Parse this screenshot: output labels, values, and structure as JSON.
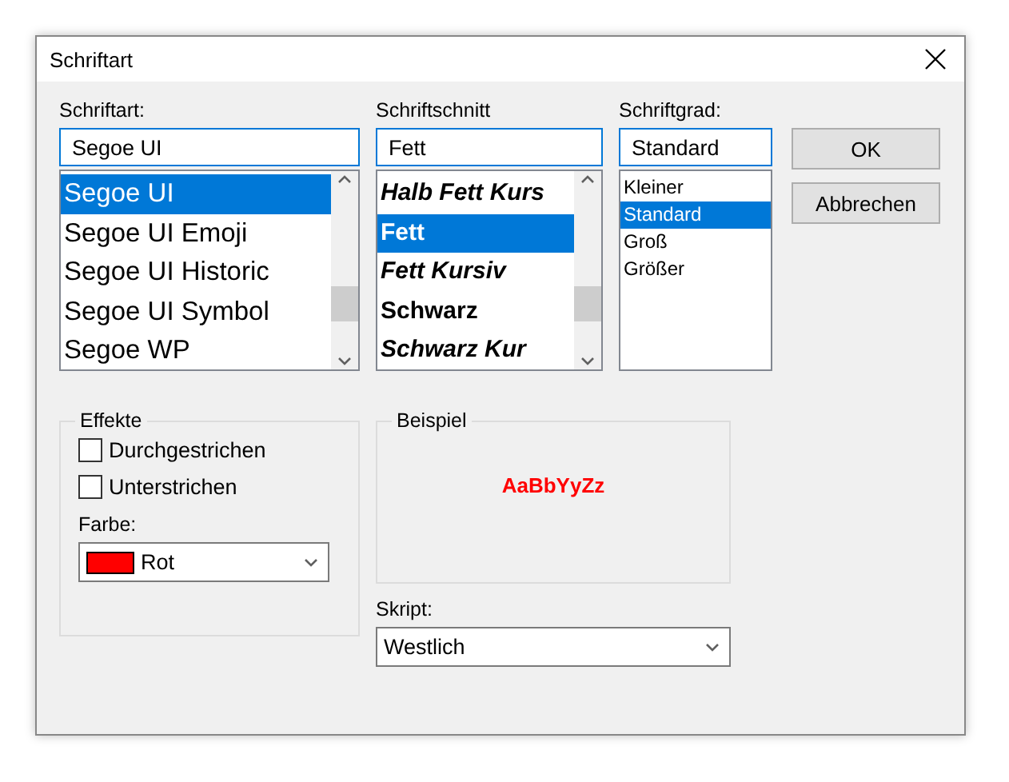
{
  "window": {
    "title": "Schriftart"
  },
  "font": {
    "label": "Schriftart:",
    "value": "Segoe UI",
    "items": [
      {
        "label": "Segoe UI",
        "selected": true
      },
      {
        "label": "Segoe UI Emoji",
        "selected": false
      },
      {
        "label": "Segoe UI Historic",
        "selected": false
      },
      {
        "label": "Segoe UI Symbol",
        "selected": false
      },
      {
        "label": "Segoe WP",
        "selected": false
      }
    ]
  },
  "style": {
    "label": "Schriftschnitt",
    "value": "Fett",
    "items": [
      {
        "label": "Halb Fett Kurs",
        "kind": "bolditalic",
        "selected": false
      },
      {
        "label": "Fett",
        "kind": "bold",
        "selected": true
      },
      {
        "label": "Fett Kursiv",
        "kind": "bolditalic",
        "selected": false
      },
      {
        "label": "Schwarz",
        "kind": "bold",
        "selected": false
      },
      {
        "label": "Schwarz Kur",
        "kind": "bolditalic",
        "selected": false
      }
    ]
  },
  "size": {
    "label": "Schriftgrad:",
    "value": "Standard",
    "items": [
      {
        "label": "Kleiner",
        "selected": false
      },
      {
        "label": "Standard",
        "selected": true
      },
      {
        "label": "Groß",
        "selected": false
      },
      {
        "label": "Größer",
        "selected": false
      }
    ]
  },
  "buttons": [
    "OK",
    "Abbrechen"
  ],
  "effects": {
    "title": "Effekte",
    "options": [
      {
        "label": "Durchgestrichen",
        "checked": false
      },
      {
        "label": "Unterstrichen",
        "checked": false
      }
    ],
    "color_label": "Farbe:",
    "color": {
      "label": "Rot",
      "color": "#ff0000"
    }
  },
  "sample": {
    "title": "Beispiel",
    "text": "AaBbYyZz"
  },
  "script": {
    "label": "Skript:",
    "value": "Westlich"
  }
}
